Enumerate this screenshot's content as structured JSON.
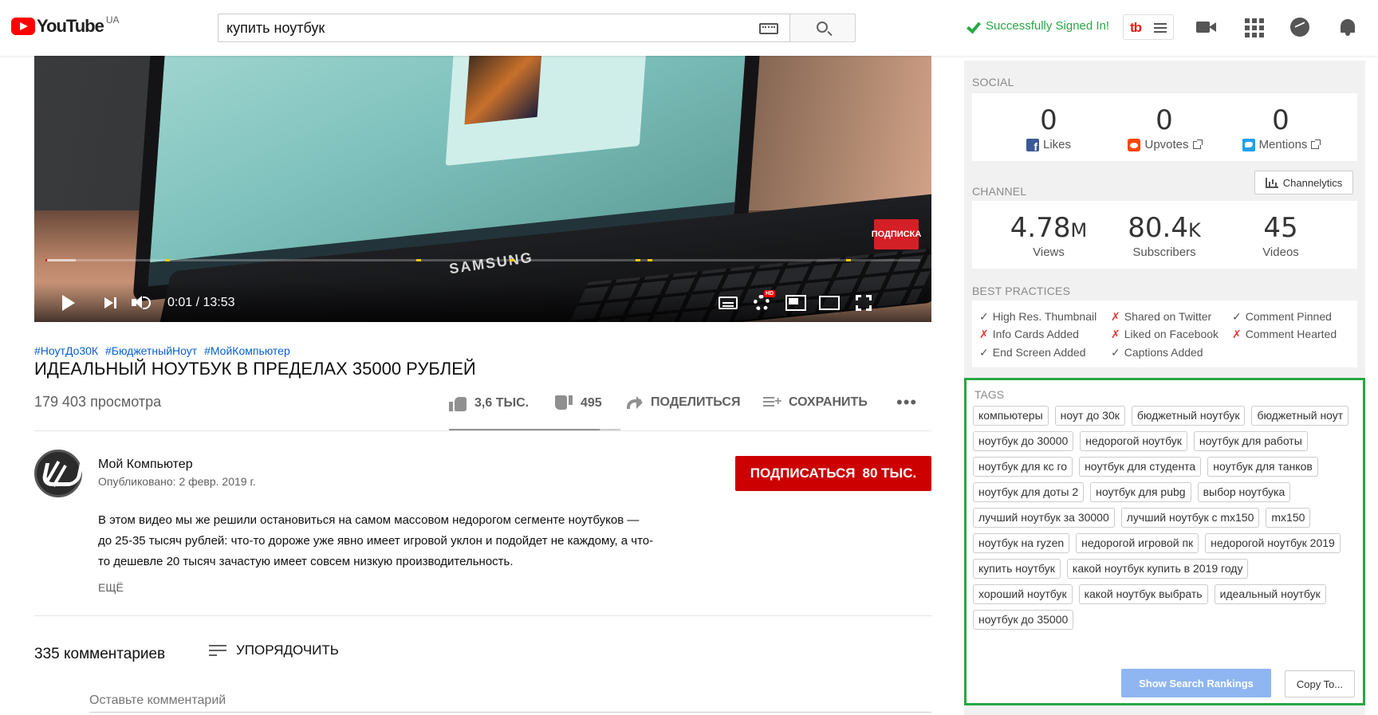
{
  "header": {
    "logo_text": "YouTube",
    "region": "UA",
    "search_value": "купить ноутбук",
    "signed_in_text": "Successfully Signed In!",
    "tb_logo": "tb"
  },
  "player": {
    "time_current": "0:01",
    "time_separator": " / ",
    "time_total": "13:53",
    "brand_text": "SAMSUNG",
    "subscribe_overlay": "ПОДПИСКА",
    "hd_badge": "HD",
    "progress_fraction": 0.0012,
    "buffered_fraction": 0.035
  },
  "video": {
    "hashtags": [
      "#НоутДо30К",
      "#БюджетныйНоут",
      "#МойКомпьютер"
    ],
    "title": "ИДЕАЛЬНЫЙ НОУТБУК В ПРЕДЕЛАХ 35000 РУБЛЕЙ",
    "views": "179 403 просмотра",
    "likes": "3,6 ТЫС.",
    "dislikes": "495",
    "share_label": "ПОДЕЛИТЬСЯ",
    "save_label": "СОХРАНИТЬ",
    "more_label": "•••",
    "like_ratio": 0.88
  },
  "channel": {
    "name": "Мой Компьютер",
    "published": "Опубликовано: 2 февр. 2019 г.",
    "subscribe_label": "ПОДПИСАТЬСЯ",
    "subscribe_count": "80 ТЫС."
  },
  "description": {
    "line1": "В этом видео мы же решили остановиться на самом массовом недорогом сегменте ноутбуков —",
    "line2": "до  25-35 тысяч рублей: что-то дороже уже явно имеет игровой уклон и подойдет не каждому, а что-",
    "line3": "то дешевле 20 тысяч зачастую имеет совсем низкую производительность.",
    "more": "ЕЩЁ"
  },
  "comments": {
    "count_label": "335 комментариев",
    "sort_label": "УПОРЯДОЧИТЬ",
    "placeholder": "Оставьте комментарий"
  },
  "sidebar": {
    "social": {
      "label": "SOCIAL",
      "likes_value": "0",
      "likes_label": "Likes",
      "upvotes_value": "0",
      "upvotes_label": "Upvotes",
      "mentions_value": "0",
      "mentions_label": "Mentions"
    },
    "channel": {
      "label": "CHANNEL",
      "button": "Channelytics",
      "views_value": "4.78",
      "views_suffix": "M",
      "views_label": "Views",
      "subs_value": "80.4",
      "subs_suffix": "K",
      "subs_label": "Subscribers",
      "videos_value": "45",
      "videos_label": "Videos"
    },
    "best_practices": {
      "label": "BEST PRACTICES",
      "items": [
        {
          "mark": "✓",
          "text": "High Res. Thumbnail",
          "ok": true
        },
        {
          "mark": "✗",
          "text": "Shared on Twitter",
          "ok": false
        },
        {
          "mark": "✓",
          "text": "Comment Pinned",
          "ok": true
        },
        {
          "mark": "✗",
          "text": "Info Cards Added",
          "ok": false
        },
        {
          "mark": "✗",
          "text": "Liked on Facebook",
          "ok": false
        },
        {
          "mark": "✗",
          "text": "Comment Hearted",
          "ok": false
        },
        {
          "mark": "✓",
          "text": "End Screen Added",
          "ok": true
        },
        {
          "mark": "✓",
          "text": "Captions Added",
          "ok": true
        }
      ]
    },
    "tags": {
      "label": "TAGS",
      "items": [
        "компьютеры",
        "ноут до 30к",
        "бюджетный ноутбук",
        "бюджетный ноут",
        "ноутбук до 30000",
        "недорогой ноутбук",
        "ноутбук для работы",
        "ноутбук для кс го",
        "ноутбук для студента",
        "ноутбук для танков",
        "ноутбук для доты 2",
        "ноутбук для pubg",
        "выбор ноутбука",
        "лучший ноутбук за 30000",
        "лучший ноутбук с mx150",
        "mx150",
        "ноутбук на ryzen",
        "недорогой игровой пк",
        "недорогой ноутбук 2019",
        "купить ноутбук",
        "какой ноутбук купить в 2019 году",
        "хороший ноутбук",
        "какой ноутбук выбрать",
        "идеальный ноутбук",
        "ноутбук до 35000"
      ],
      "rank_button": "Show Search Rankings",
      "copy_button": "Copy To..."
    }
  },
  "colors": {
    "accent_red": "#cc0000",
    "link_blue": "#065fd4",
    "tags_border": "#28a745",
    "rank_button": "#8fb6f0"
  }
}
